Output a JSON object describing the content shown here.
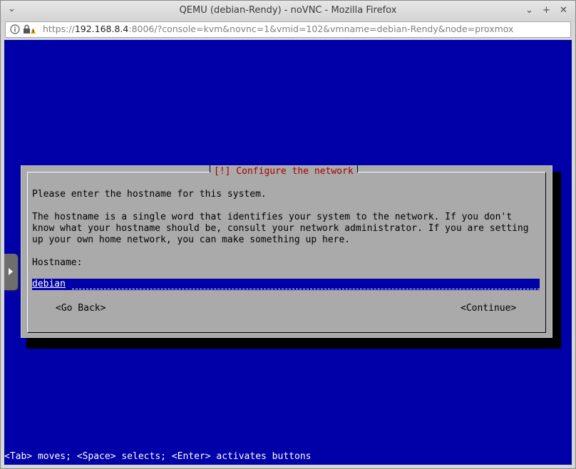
{
  "window": {
    "title": "QEMU (debian-Rendy) - noVNC - Mozilla Firefox",
    "minimize_glyph": "⌄",
    "maximize_glyph": "+",
    "close_glyph": "✕"
  },
  "urlbar": {
    "scheme": "https://",
    "host": "192.168.8.4",
    "rest": ":8006/?console=kvm&novnc=1&vmid=102&vmname=debian-Rendy&node=proxmox"
  },
  "installer": {
    "dialog_title": "[!] Configure the network",
    "prompt": "Please enter the hostname for this system.",
    "description_lines": [
      "The hostname is a single word that identifies your system to the network. If you don't",
      "know what your hostname should be, consult your network administrator. If you are setting",
      "up your own home network, you can make something up here."
    ],
    "field_label": "Hostname:",
    "hostname_value": "debian",
    "go_back_label": "<Go Back>",
    "continue_label": "<Continue>",
    "status_line": "<Tab> moves; <Space> selects; <Enter> activates buttons"
  },
  "colors": {
    "console_bg": "#0000a8",
    "dialog_bg": "#aaaaaa",
    "dialog_title": "#a80000"
  }
}
